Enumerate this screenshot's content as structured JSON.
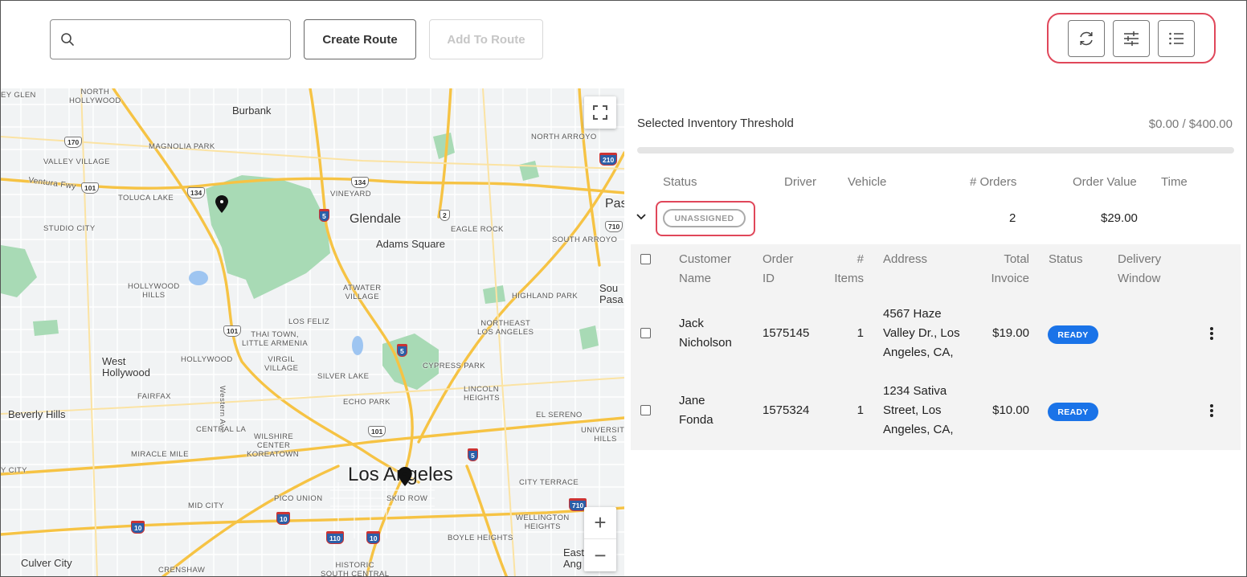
{
  "toolbar": {
    "search_placeholder": "",
    "search_icon": "search-icon",
    "create_route_label": "Create Route",
    "add_to_route_label": "Add To Route",
    "icons": [
      "refresh-icon",
      "sliders-icon",
      "list-icon"
    ]
  },
  "map": {
    "labels": {
      "north_hollywood": "NORTH\nHOLLYWOOD",
      "valley_glen": "EY GLEN",
      "burbank": "Burbank",
      "magnolia_park": "MAGNOLIA PARK",
      "valley_village": "VALLEY VILLAGE",
      "ventura_fwy": "Ventura Fwy",
      "toluca_lake": "TOLUCA LAKE",
      "north_arroyo": "NORTH ARROYO",
      "vineyard": "VINEYARD",
      "glendale": "Glendale",
      "studio_city": "STUDIO CITY",
      "adams_square": "Adams Square",
      "eagle_rock": "EAGLE ROCK",
      "south_arroyo": "SOUTH ARROYO",
      "pasadena_partial": "Pas",
      "hollywood_hills": "HOLLYWOOD\nHILLS",
      "atwater_village": "ATWATER\nVILLAGE",
      "highland_park": "HIGHLAND PARK",
      "south_pasadena_partial": "Sou\nPasa",
      "los_feliz": "LOS FELIZ",
      "thai_town": "THAI TOWN,\nLITTLE ARMENIA",
      "northeast_la": "NORTHEAST\nLOS ANGELES",
      "west_hollywood": "West\nHollywood",
      "hollywood": "HOLLYWOOD",
      "virgil_village": "VIRGIL\nVILLAGE",
      "cypress_park": "CYPRESS PARK",
      "silver_lake": "SILVER LAKE",
      "fairfax": "FAIRFAX",
      "echo_park": "ECHO PARK",
      "western_ave": "Western Ave",
      "beverly_hills": "Beverly Hills",
      "lincoln_heights": "LINCOLN\nHEIGHTS",
      "el_sereno": "EL SERENO",
      "central_la": "CENTRAL LA",
      "wilshire_center": "WILSHIRE\nCENTER",
      "university_hills": "UNIVERSITY\nHILLS",
      "y_city": "Y CITY",
      "miracle_mile": "MIRACLE MILE",
      "koreatown": "KOREATOWN",
      "los_angeles": "Los Angeles",
      "city_terrace": "CITY TERRACE",
      "pico_union": "PICO UNION",
      "skid_row": "SKID ROW",
      "mid_city": "MID CITY",
      "wellington_heights": "WELLINGTON\nHEIGHTS",
      "boyle_heights": "BOYLE HEIGHTS",
      "culver_city": "Culver City",
      "crenshaw": "CRENSHAW",
      "historic_south_central": "HISTORIC\nSOUTH CENTRAL",
      "east_la_partial": "East\nAng"
    },
    "shields": [
      "170",
      "101",
      "134",
      "134",
      "5",
      "2",
      "210",
      "710",
      "101",
      "5",
      "101",
      "5",
      "10",
      "10",
      "110",
      "10",
      "710"
    ],
    "zoom_in": "+",
    "zoom_out": "−"
  },
  "panel": {
    "threshold_label": "Selected Inventory Threshold",
    "threshold_value": "$0.00 / $400.00",
    "threshold_fraction": 0.0,
    "headers": {
      "status": "Status",
      "driver": "Driver",
      "vehicle": "Vehicle",
      "orders": "# Orders",
      "order_value": "Order Value",
      "time": "Time"
    },
    "route": {
      "status": "UNASSIGNED",
      "orders": "2",
      "order_value": "$29.00"
    },
    "order_headers": {
      "customer_name": "Customer\nName",
      "order_id": "Order\nID",
      "items": "#\nItems",
      "address": "Address",
      "total_invoice": "Total\nInvoice",
      "status": "Status",
      "delivery_window": "Delivery\nWindow"
    },
    "orders": [
      {
        "customer": "Jack\nNicholson",
        "order_id": "1575145",
        "items": "1",
        "address": "4567 Haze\nValley Dr., Los\nAngeles, CA,",
        "total": "$19.00",
        "status": "READY"
      },
      {
        "customer": "Jane\nFonda",
        "order_id": "1575324",
        "items": "1",
        "address": "1234 Sativa\nStreet, Los\nAngeles, CA,",
        "total": "$10.00",
        "status": "READY"
      }
    ]
  },
  "colors": {
    "accent": "#1a73e8",
    "highlight": "#e0475a",
    "park": "#a8dab5",
    "highway": "#f9c74f"
  }
}
